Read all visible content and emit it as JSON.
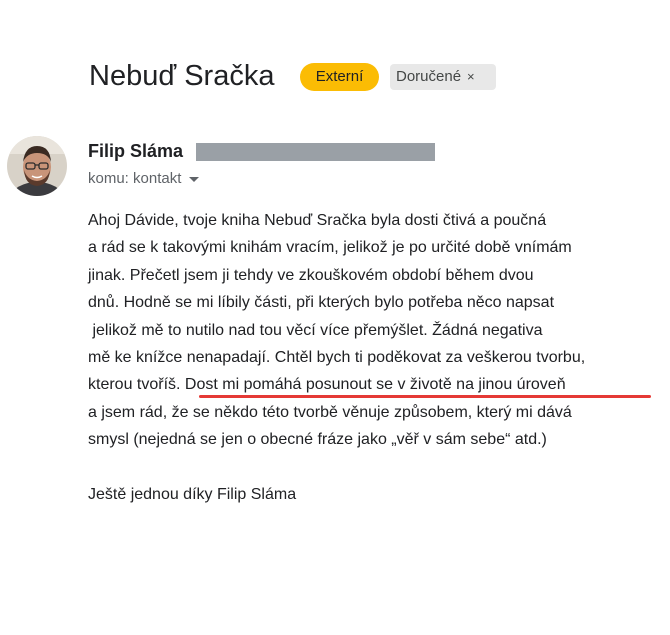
{
  "email": {
    "subject": "Nebuď Sračka",
    "labels": {
      "external": "Externí",
      "inbox": "Doručené",
      "inbox_close": "×"
    },
    "sender": {
      "name": "Filip Sláma",
      "to": "komu: kontakt"
    },
    "body_lines": [
      "Ahoj Dávide, tvoje kniha Nebuď Sračka byla dosti čtivá a poučná",
      "a rád se k takovými knihám vracím, jelikož je po určité době vnímám",
      "jinak. Přečetl jsem ji tehdy ve zkouškovém období během dvou",
      "dnů. Hodně se mi líbily části, při kterých bylo potřeba něco napsat",
      " jelikož mě to nutilo nad tou věcí více přemýšlet. Žádná negativa",
      "mě ke knížce nenapadají. Chtěl bych ti poděkovat za veškerou tvorbu,",
      "kterou tvoříš. Dost mi pomáhá posunout se v životě na jinou úroveň",
      "a jsem rád, že se někdo této tvorbě věnuje způsobem, který mi dává",
      "smysl (nejedná se jen o obecné fráze jako „věř v sám sebe“ atd.)"
    ],
    "signature": "Ještě jednou díky Filip Sláma"
  },
  "colors": {
    "external_badge": "#fbbc04",
    "inbox_badge": "#e8e8e8",
    "highlight_underline": "#e53935",
    "redaction": "#9aa0a6"
  },
  "icons": {
    "to_dropdown": "chevron-down-icon",
    "label_close": "close-icon"
  }
}
